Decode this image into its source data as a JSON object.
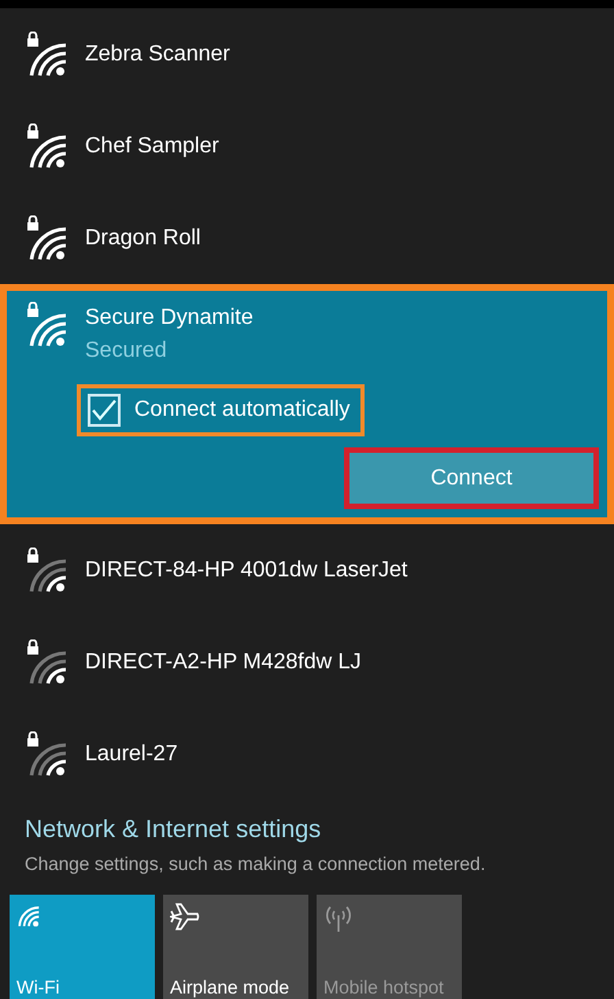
{
  "networks": [
    {
      "name": "Zebra Scanner",
      "kind": "strong",
      "secured": true,
      "expanded": false
    },
    {
      "name": "Chef Sampler",
      "kind": "strong",
      "secured": true,
      "expanded": false
    },
    {
      "name": "Dragon Roll",
      "kind": "strong",
      "secured": true,
      "expanded": false
    },
    {
      "name": "Secure Dynamite",
      "kind": "strong",
      "secured": true,
      "expanded": true,
      "status": "Secured",
      "auto_connect": {
        "label": "Connect automatically",
        "checked": true
      },
      "button": "Connect"
    },
    {
      "name": "DIRECT-84-HP 4001dw LaserJet",
      "kind": "weak",
      "secured": true,
      "expanded": false
    },
    {
      "name": "DIRECT-A2-HP M428fdw LJ",
      "kind": "weak",
      "secured": true,
      "expanded": false
    },
    {
      "name": "Laurel-27",
      "kind": "weak",
      "secured": true,
      "expanded": false
    }
  ],
  "settings": {
    "title": "Network & Internet settings",
    "subtitle": "Change settings, such as making a connection metered."
  },
  "tiles": [
    {
      "label": "Wi-Fi",
      "kind": "wifi",
      "on": true,
      "disabled": false
    },
    {
      "label": "Airplane mode",
      "kind": "airplane",
      "on": false,
      "disabled": false
    },
    {
      "label": "Mobile hotspot",
      "kind": "hotspot",
      "on": false,
      "disabled": true
    }
  ]
}
